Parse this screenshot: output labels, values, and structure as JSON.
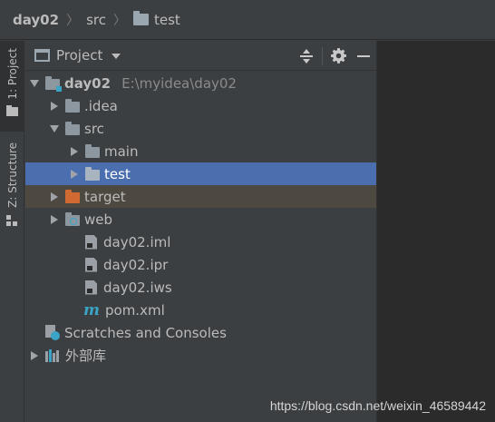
{
  "breadcrumb": {
    "items": [
      "day02",
      "src",
      "test"
    ],
    "separator": "〉"
  },
  "tool_strip": {
    "project_tab": "1: Project",
    "structure_tab": "Z: Structure"
  },
  "panel": {
    "title": "Project",
    "actions": [
      "collapse-all",
      "settings",
      "hide"
    ]
  },
  "tree": {
    "root_name": "day02",
    "root_path": "E:\\myidea\\day02",
    "idea": ".idea",
    "src": "src",
    "main": "main",
    "test": "test",
    "target": "target",
    "web": "web",
    "iml": "day02.iml",
    "ipr": "day02.ipr",
    "iws": "day02.iws",
    "pom": "pom.xml",
    "scratches": "Scratches and Consoles",
    "external_libs": "外部库"
  },
  "watermark": "https://blog.csdn.net/weixin_46589442",
  "colors": {
    "background": "#3c3f41",
    "editor": "#2b2b2b",
    "selection": "#4b6eaf",
    "excluded": "#4d4840",
    "excluded_folder": "#d16a32",
    "accent": "#3aa4c7"
  }
}
